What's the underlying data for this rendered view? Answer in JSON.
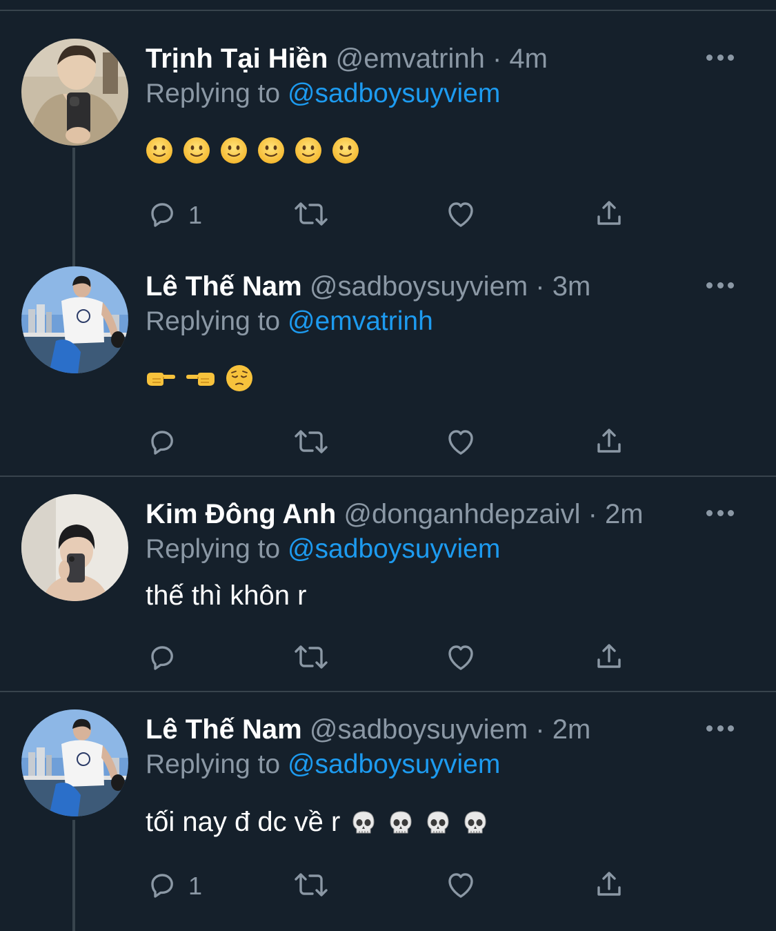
{
  "tweets": [
    {
      "name": "Trịnh Tại Hiền",
      "handle": "@emvatrinh",
      "separator": "·",
      "time": "4m",
      "replying_prefix": "Replying to",
      "replying_to": "@sadboysuyviem",
      "text": "",
      "emojis": [
        "slightly-smiling-face",
        "slightly-smiling-face",
        "slightly-smiling-face",
        "slightly-smiling-face",
        "slightly-smiling-face",
        "slightly-smiling-face"
      ],
      "reply_count": "1",
      "avatar": "mirror-selfie-beige-shirt"
    },
    {
      "name": "Lê Thế Nam",
      "handle": "@sadboysuyviem",
      "separator": "·",
      "time": "3m",
      "replying_prefix": "Replying to",
      "replying_to": "@emvatrinh",
      "text": "",
      "emojis": [
        "pointing-right",
        "pointing-left",
        "pensive-face"
      ],
      "reply_count": "",
      "avatar": "man-white-shirt-harbor"
    },
    {
      "name": "Kim Đông Anh",
      "handle": "@donganhdepzaivl",
      "separator": "·",
      "time": "2m",
      "replying_prefix": "Replying to",
      "replying_to": "@sadboysuyviem",
      "text": "thế thì khôn r",
      "emojis": [],
      "reply_count": "",
      "avatar": "mirror-selfie-white-wall"
    },
    {
      "name": "Lê Thế Nam",
      "handle": "@sadboysuyviem",
      "separator": "·",
      "time": "2m",
      "replying_prefix": "Replying to",
      "replying_to": "@sadboysuyviem",
      "text": "tối nay đ dc về r",
      "emojis": [
        "skull",
        "skull",
        "skull",
        "skull"
      ],
      "reply_count": "1",
      "avatar": "man-white-shirt-harbor"
    }
  ],
  "colors": {
    "background": "#15202b",
    "divider": "#38444d",
    "secondary_text": "#8b98a5",
    "link": "#1d9bf0",
    "icon": "#8b98a5"
  },
  "icons": [
    "reply-icon",
    "retweet-icon",
    "like-icon",
    "share-icon",
    "more-icon"
  ]
}
